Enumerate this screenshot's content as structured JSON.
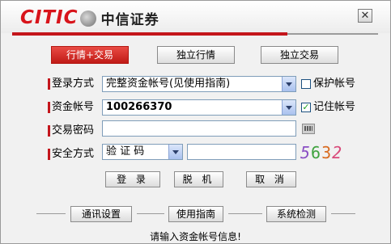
{
  "brand": {
    "logo_text": "CITIC",
    "logo_cn": "中信证券"
  },
  "window": {
    "close_label": "✕"
  },
  "mode_tabs": [
    {
      "label": "行情+交易",
      "active": true
    },
    {
      "label": "独立行情",
      "active": false
    },
    {
      "label": "独立交易",
      "active": false
    }
  ],
  "form": {
    "login_method": {
      "label": "登录方式",
      "value": "完整资金帐号(见使用指南)"
    },
    "protect_account": {
      "label": "保护帐号",
      "checked": false
    },
    "account": {
      "label": "资金帐号",
      "value": "100266370"
    },
    "remember_account": {
      "label": "记住帐号",
      "checked": true,
      "check_glyph": "✓"
    },
    "password": {
      "label": "交易密码",
      "value": ""
    },
    "security": {
      "label": "安全方式",
      "value": "验 证 码",
      "input_value": ""
    },
    "captcha": [
      "5",
      "6",
      "3",
      "2"
    ]
  },
  "buttons": {
    "login": "登 录",
    "offline": "脱 机",
    "cancel": "取 消"
  },
  "footer": {
    "comm_settings": "通讯设置",
    "user_guide": "使用指南",
    "system_check": "系统检测"
  },
  "status_message": "请输入资金帐号信息!",
  "colors": {
    "accent": "#c4161c",
    "captcha": [
      "#8a4fc4",
      "#3fa33f",
      "#d96b20",
      "#d94a7a"
    ]
  }
}
